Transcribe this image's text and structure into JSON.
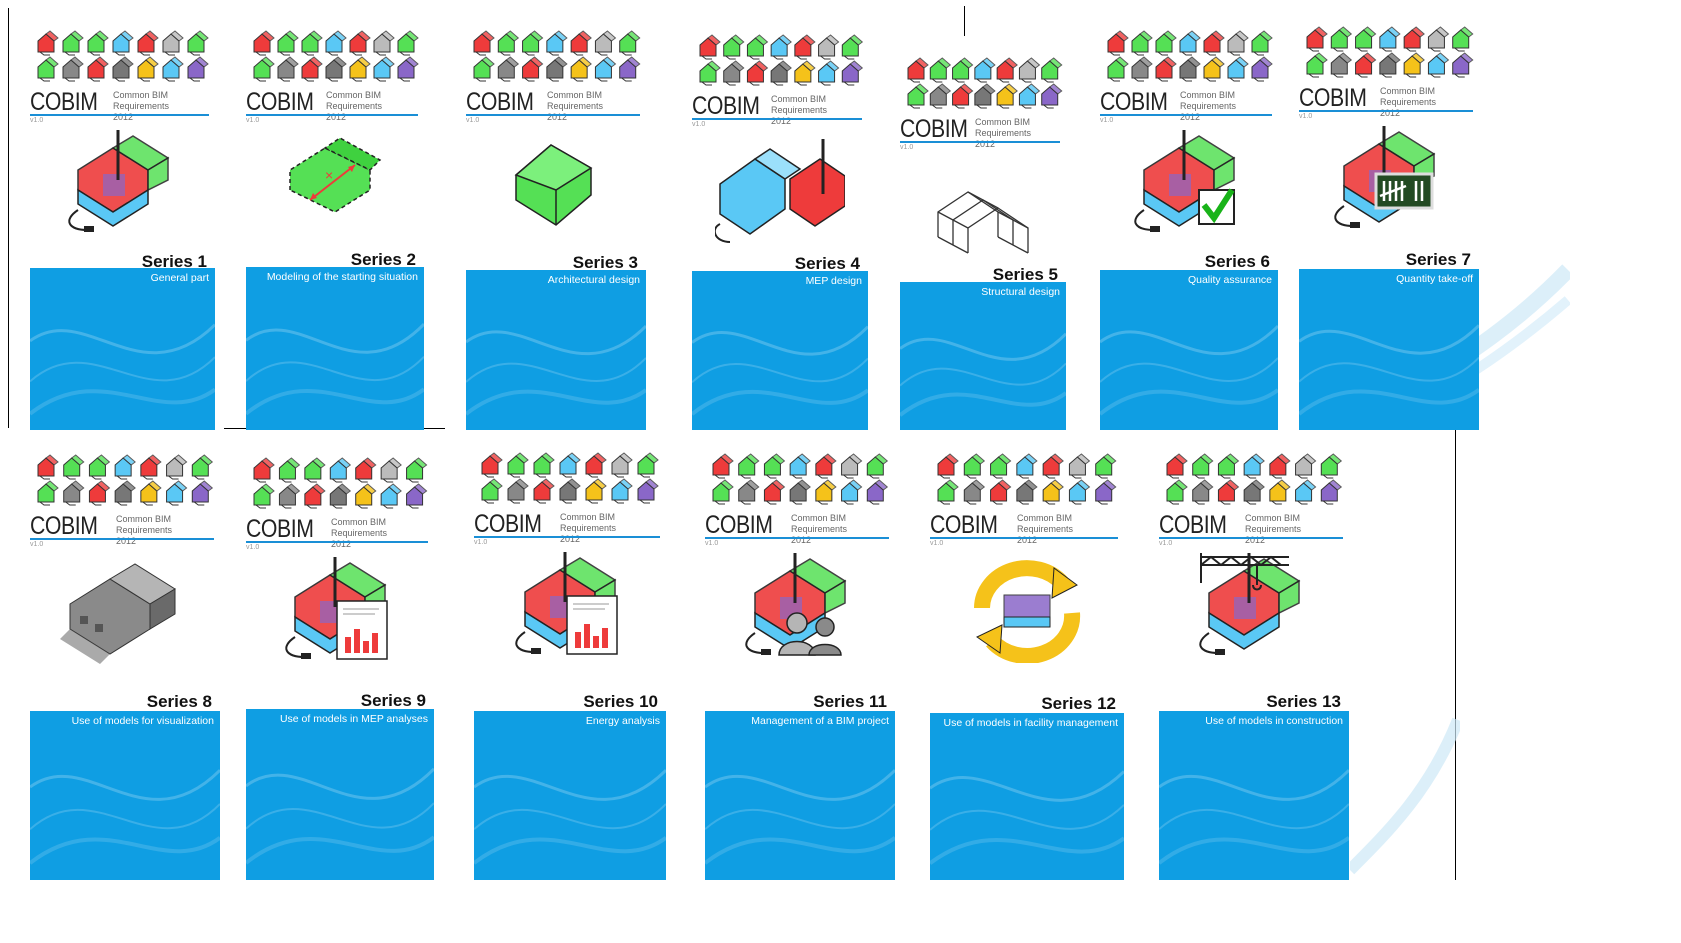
{
  "brand": {
    "logo": "COBIM",
    "line1": "Common BIM Requirements",
    "line2": "2012",
    "version": "v1.0"
  },
  "colors": {
    "panel": "#0f9ee3",
    "rule": "#1a8fd6",
    "green": "#55e055",
    "blue": "#5ac8f5",
    "red": "#ee3b3b",
    "purple": "#8a67c8",
    "yellow": "#f5c21a"
  },
  "series": [
    {
      "title": "Series 1",
      "subtitle": "General part",
      "icon": "building-services-icon"
    },
    {
      "title": "Series 2",
      "subtitle": "Modeling of the starting situation",
      "icon": "existing-building-icon"
    },
    {
      "title": "Series 3",
      "subtitle": "Architectural design",
      "icon": "architectural-mass-icon"
    },
    {
      "title": "Series 4",
      "subtitle": "MEP design",
      "icon": "mep-buildings-icon"
    },
    {
      "title": "Series 5",
      "subtitle": "Structural design",
      "icon": "structural-frame-icon"
    },
    {
      "title": "Series 6",
      "subtitle": "Quality assurance",
      "icon": "checkmark-icon"
    },
    {
      "title": "Series 7",
      "subtitle": "Quantity take-off",
      "icon": "tally-board-icon"
    },
    {
      "title": "Series 8",
      "subtitle": "Use of models for visualization",
      "icon": "rendered-building-icon"
    },
    {
      "title": "Series 9",
      "subtitle": "Use of models in MEP analyses",
      "icon": "bar-chart-report-icon"
    },
    {
      "title": "Series 10",
      "subtitle": "Energy analysis",
      "icon": "bar-chart-report-icon"
    },
    {
      "title": "Series 11",
      "subtitle": "Management of a BIM project",
      "icon": "people-icon"
    },
    {
      "title": "Series 12",
      "subtitle": "Use of models in facility management",
      "icon": "cycle-arrows-icon"
    },
    {
      "title": "Series 13",
      "subtitle": "Use of models in construction",
      "icon": "crane-icon"
    }
  ]
}
